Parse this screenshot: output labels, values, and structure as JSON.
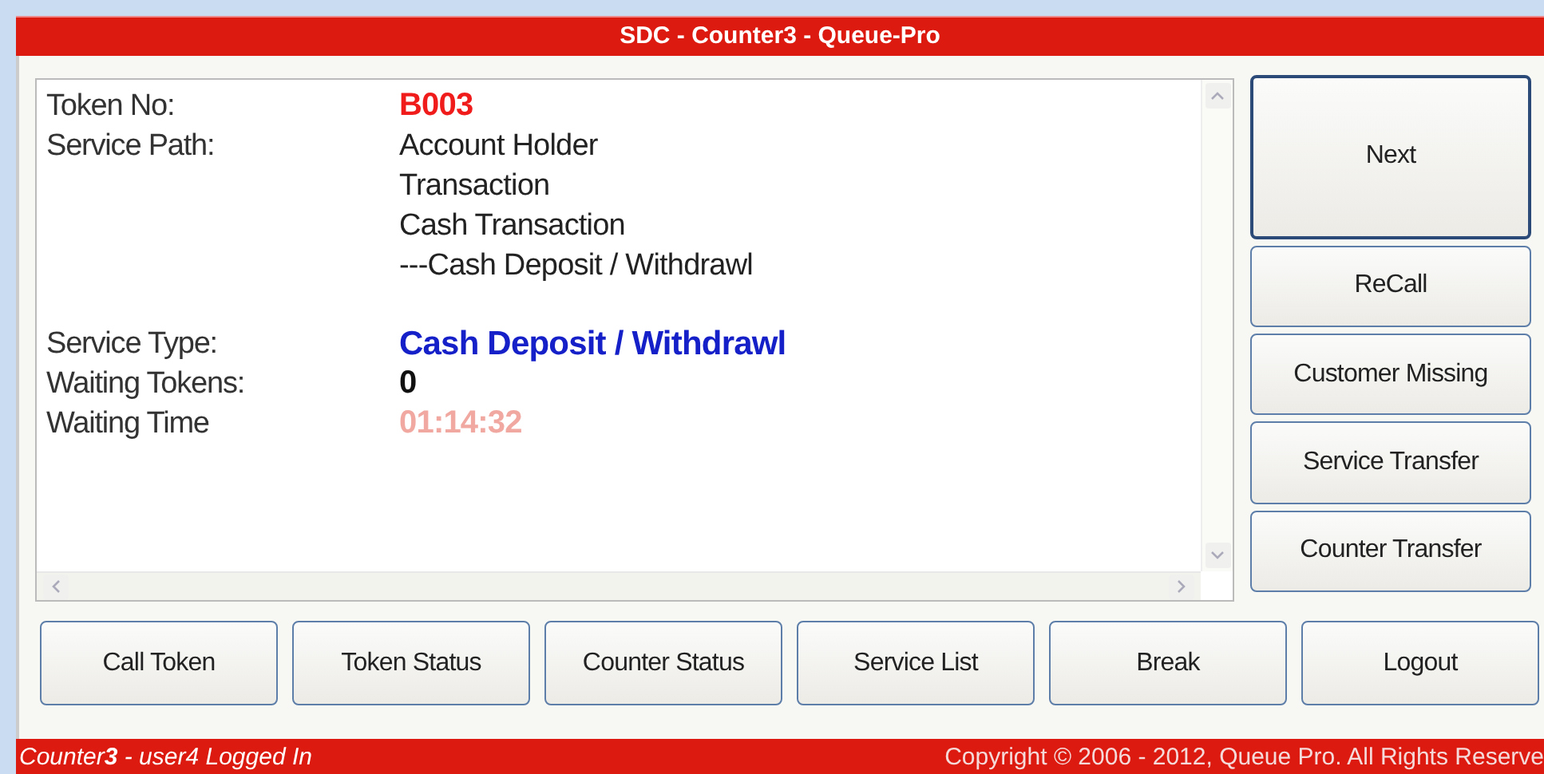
{
  "window": {
    "title": "SDC - Counter**3** - Queue-Pro"
  },
  "details": [
    {
      "label": "Token No:",
      "kind": "token",
      "values": [
        "B003"
      ]
    },
    {
      "label": "Service Path:",
      "kind": "path",
      "values": [
        "Account Holder",
        "Transaction",
        "Cash Transaction",
        "---Cash Deposit / Withdrawl"
      ]
    },
    {
      "label": "Service Type:",
      "kind": "type",
      "values": [
        "Cash Deposit / Withdrawl"
      ]
    },
    {
      "label": "Waiting Tokens:",
      "kind": "count",
      "values": [
        "0"
      ]
    },
    {
      "label": "Waiting Time",
      "kind": "time",
      "values": [
        "01:14:32"
      ]
    }
  ],
  "side_buttons": [
    {
      "label": "Next",
      "focused": true
    },
    {
      "label": "ReCall",
      "focused": false
    },
    {
      "label": "Customer Missing",
      "focused": false
    },
    {
      "label": "Service Transfer",
      "focused": false
    },
    {
      "label": "Counter Transfer",
      "focused": false
    }
  ],
  "bottom_buttons": [
    "Call Token",
    "Token Status",
    "Counter Status",
    "Service List",
    "Break",
    "Logout"
  ],
  "status_bar": {
    "left": "Counter**3** - user4 Logged In",
    "right": "Copyright © 2006 - 2012, Queue Pro. All Rights Reserve"
  }
}
